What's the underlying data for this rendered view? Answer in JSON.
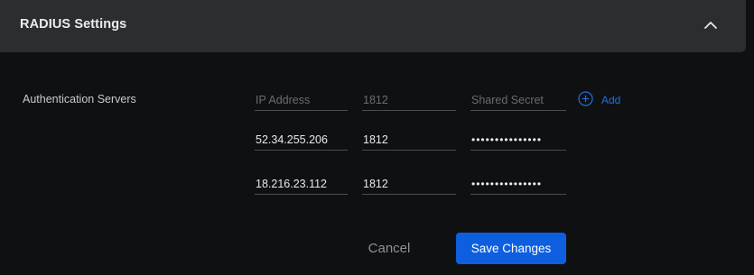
{
  "header": {
    "title": "RADIUS Settings",
    "collapse_icon": "chevron-up-icon"
  },
  "auth_servers": {
    "label": "Authentication Servers",
    "placeholders": {
      "ip": "IP Address",
      "port": "1812",
      "secret": "Shared Secret"
    },
    "add_label": "Add",
    "add_icon": "plus-circle-icon",
    "servers": [
      {
        "ip": "52.34.255.206",
        "port": "1812",
        "secret": "•••••••••••••••"
      },
      {
        "ip": "18.216.23.112",
        "port": "1812",
        "secret": "•••••••••••••••"
      }
    ]
  },
  "actions": {
    "cancel_label": "Cancel",
    "save_label": "Save Changes"
  },
  "colors": {
    "background": "#0f1012",
    "header_bg": "#2c2d31",
    "accent": "#0d5fe0",
    "link": "#1f6fe0"
  }
}
